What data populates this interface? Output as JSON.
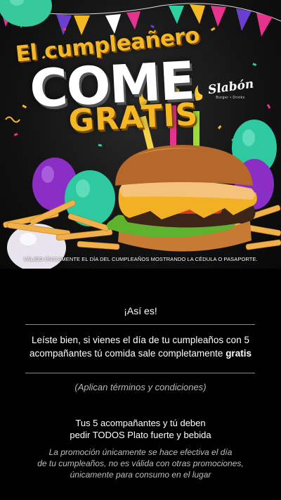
{
  "banner": {
    "title_line1": "El cumpleañero",
    "title_line2": "COME",
    "title_line3": "GRATIS",
    "logo_text": "Slabón",
    "logo_subtext": "Burger • Drinks",
    "disclaimer": "VÁLIDO ÚNICAMENTE EL DÍA DEL CUMPLEAÑOS MOSTRANDO LA CÉDULA O PASAPORTE.",
    "colors": {
      "gold": "#f4b825",
      "background": "#121212"
    }
  },
  "info": {
    "heading": "¡Así es!",
    "paragraph_main": "Leíste bien, si vienes el día de tu cumpleaños con 5 acompañantes tú comida sale completamente ",
    "paragraph_bold": "gratis",
    "terms": "(Aplican términos y condiciones)",
    "must_order_line1": "Tus 5 acompañantes y tú deben",
    "must_order_line2": "pedir TODOS Plato fuerte y bebida",
    "restrictions_line1": "La promoción únicamente se hace efectiva el día",
    "restrictions_line2": "de tu cumpleaños, no es válida con otras promociones,",
    "restrictions_line3": "únicamente para consumo en el lugar"
  }
}
